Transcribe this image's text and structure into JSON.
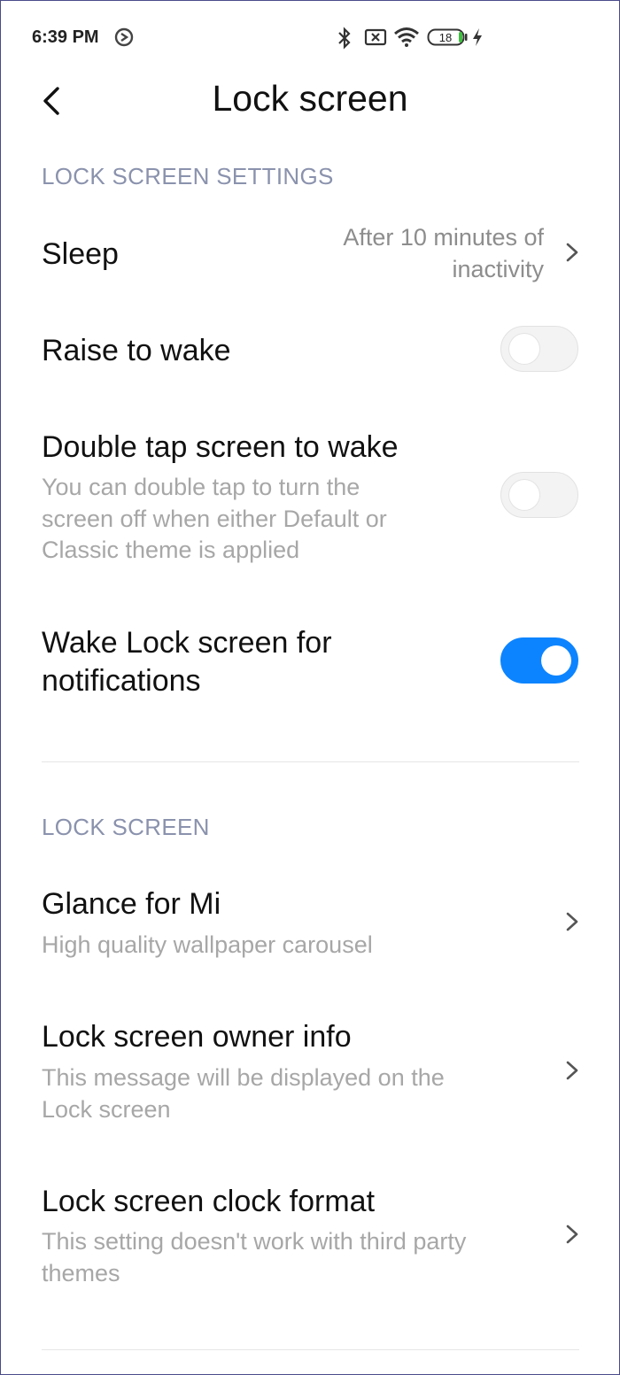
{
  "status_bar": {
    "time": "6:39 PM",
    "battery": "18",
    "icons": [
      "sync-icon",
      "bluetooth-icon",
      "no-sim-icon",
      "wifi-icon",
      "battery-icon",
      "charging-icon"
    ]
  },
  "header": {
    "title": "Lock screen"
  },
  "sections": [
    {
      "header": "LOCK SCREEN SETTINGS"
    },
    {
      "header": "LOCK SCREEN"
    }
  ],
  "settings": {
    "sleep": {
      "title": "Sleep",
      "value_line1": "After 10 minutes of",
      "value_line2": "inactivity"
    },
    "raise_to_wake": {
      "title": "Raise to wake",
      "enabled": false
    },
    "double_tap": {
      "title": "Double tap screen to wake",
      "sub_line1": "You can double tap to turn the",
      "sub_line2": "screen off when either Default or",
      "sub_line3": "Classic theme is applied",
      "enabled": false
    },
    "wake_notifications": {
      "title_line1": "Wake Lock screen for",
      "title_line2": "notifications",
      "enabled": true
    },
    "glance": {
      "title": "Glance for Mi",
      "sub_line1": "High quality wallpaper carousel"
    },
    "owner_info": {
      "title": "Lock screen owner info",
      "sub_line1": "This message will be displayed on the",
      "sub_line2": "Lock screen"
    },
    "clock_format": {
      "title": "Lock screen clock format",
      "sub_line1": "This setting doesn't work with third party",
      "sub_line2": "themes"
    }
  },
  "colors": {
    "accent": "#0d84ff",
    "section_header": "#8a92ad",
    "subtitle": "#a7a7a7"
  }
}
